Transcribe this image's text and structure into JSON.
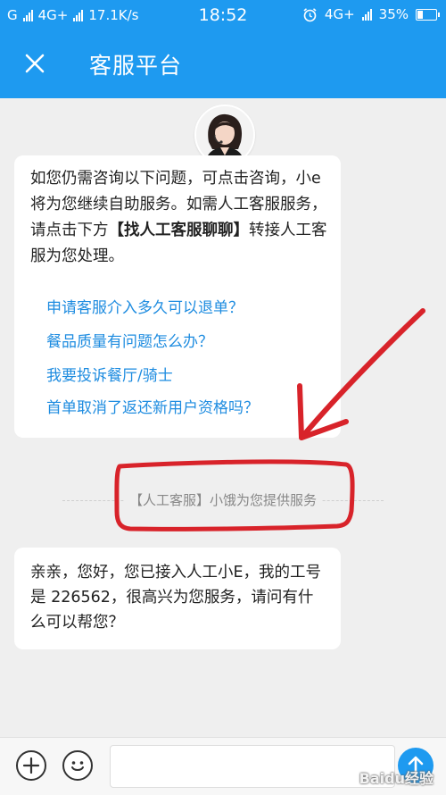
{
  "status_bar": {
    "carrier_left": "G",
    "network_left": "4G+",
    "speed": "17.1K/s",
    "time": "18:52",
    "network_right": "4G+",
    "battery": "35%",
    "battery_level": 0.35
  },
  "header": {
    "title": "客服平台",
    "close_icon": "close-icon"
  },
  "agent_avatar": "customer-service-agent-avatar",
  "messages": [
    {
      "text_before": "如您仍需咨询以下问题，可点击咨询，小e将为您继续自助服务。如需人工客服服务，请点击下方",
      "text_bold": "【找人工客服聊聊】",
      "text_after": "转接人工客服为您处理。",
      "links": [
        "申请客服介入多久可以退单？",
        "餐品质量有问题怎么办？",
        "我要投诉餐厅/骑士",
        "首单取消了返还新用户资格吗？"
      ]
    }
  ],
  "system_notice": "【人工客服】小饿为您提供服务",
  "agent_reply": "亲亲，您好，您已接入人工小E，我的工号是 226562，很高兴为您服务，请问有什么可以帮您？",
  "input_bar": {
    "add_icon": "plus-icon",
    "emoji_icon": "emoji-icon",
    "input_value": "",
    "send_icon": "send-icon"
  },
  "watermark": "Baidu经验",
  "colors": {
    "header_blue": "#1e9af0",
    "link_blue": "#1e8ce0",
    "annotation_red": "#d8232a",
    "background": "#efefef"
  }
}
